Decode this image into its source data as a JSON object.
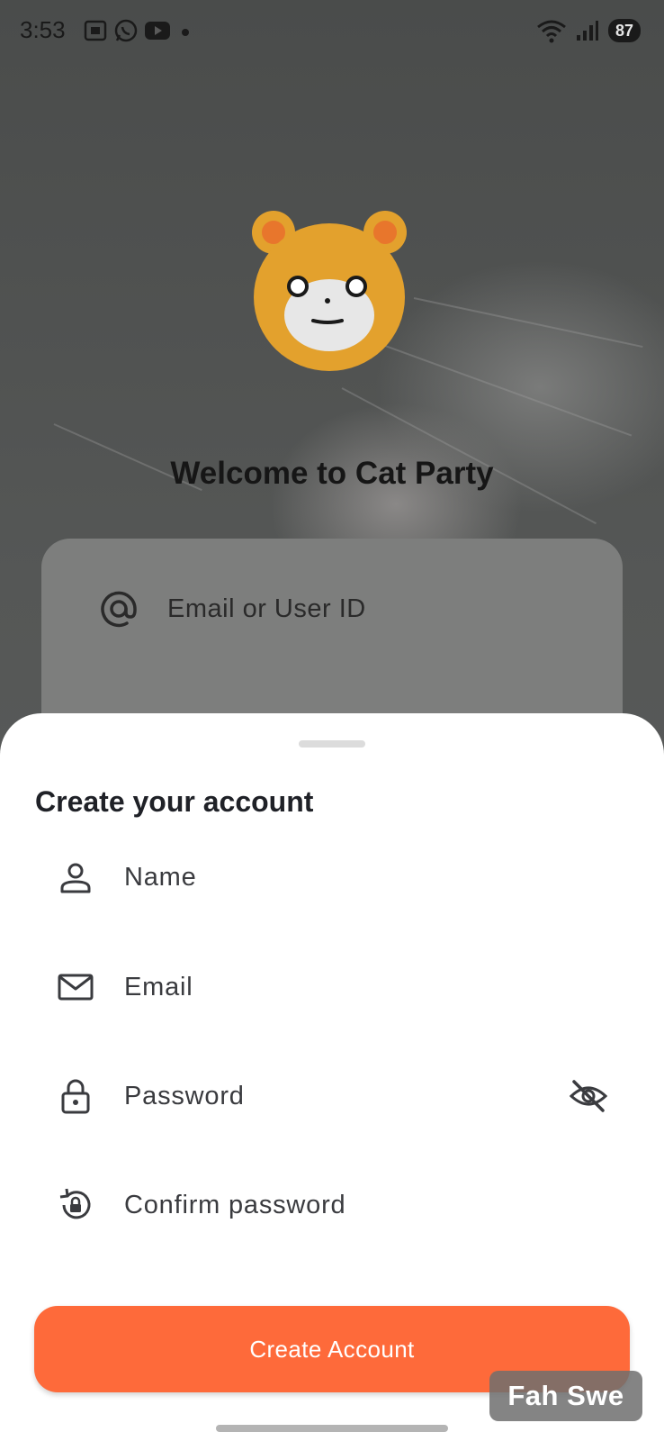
{
  "status_bar": {
    "time": "3:53",
    "battery": "87",
    "icons_left": [
      "screenshot-icon",
      "whatsapp-icon",
      "youtube-icon",
      "notification-dot-icon"
    ],
    "icons_right": [
      "wifi-icon",
      "signal-icon",
      "battery-icon"
    ]
  },
  "background_screen": {
    "title": "Welcome to Cat Party",
    "login_fields": [
      {
        "label": "Email or User ID",
        "icon": "at-sign-icon"
      }
    ]
  },
  "sheet": {
    "title": "Create your account",
    "fields": [
      {
        "label": "Name",
        "icon": "person-icon"
      },
      {
        "label": "Email",
        "icon": "mail-icon"
      },
      {
        "label": "Password",
        "icon": "lock-icon",
        "trailing_icon": "eye-off-icon"
      },
      {
        "label": "Confirm password",
        "icon": "lock-reset-icon"
      }
    ],
    "button_label": "Create Account"
  },
  "watermark": "Fah Swe",
  "colors": {
    "accent": "#fe6a3a",
    "bear_face": "#e3a12d",
    "bear_muzzle": "#e7e7e7",
    "sheet_background": "#ffffff"
  }
}
